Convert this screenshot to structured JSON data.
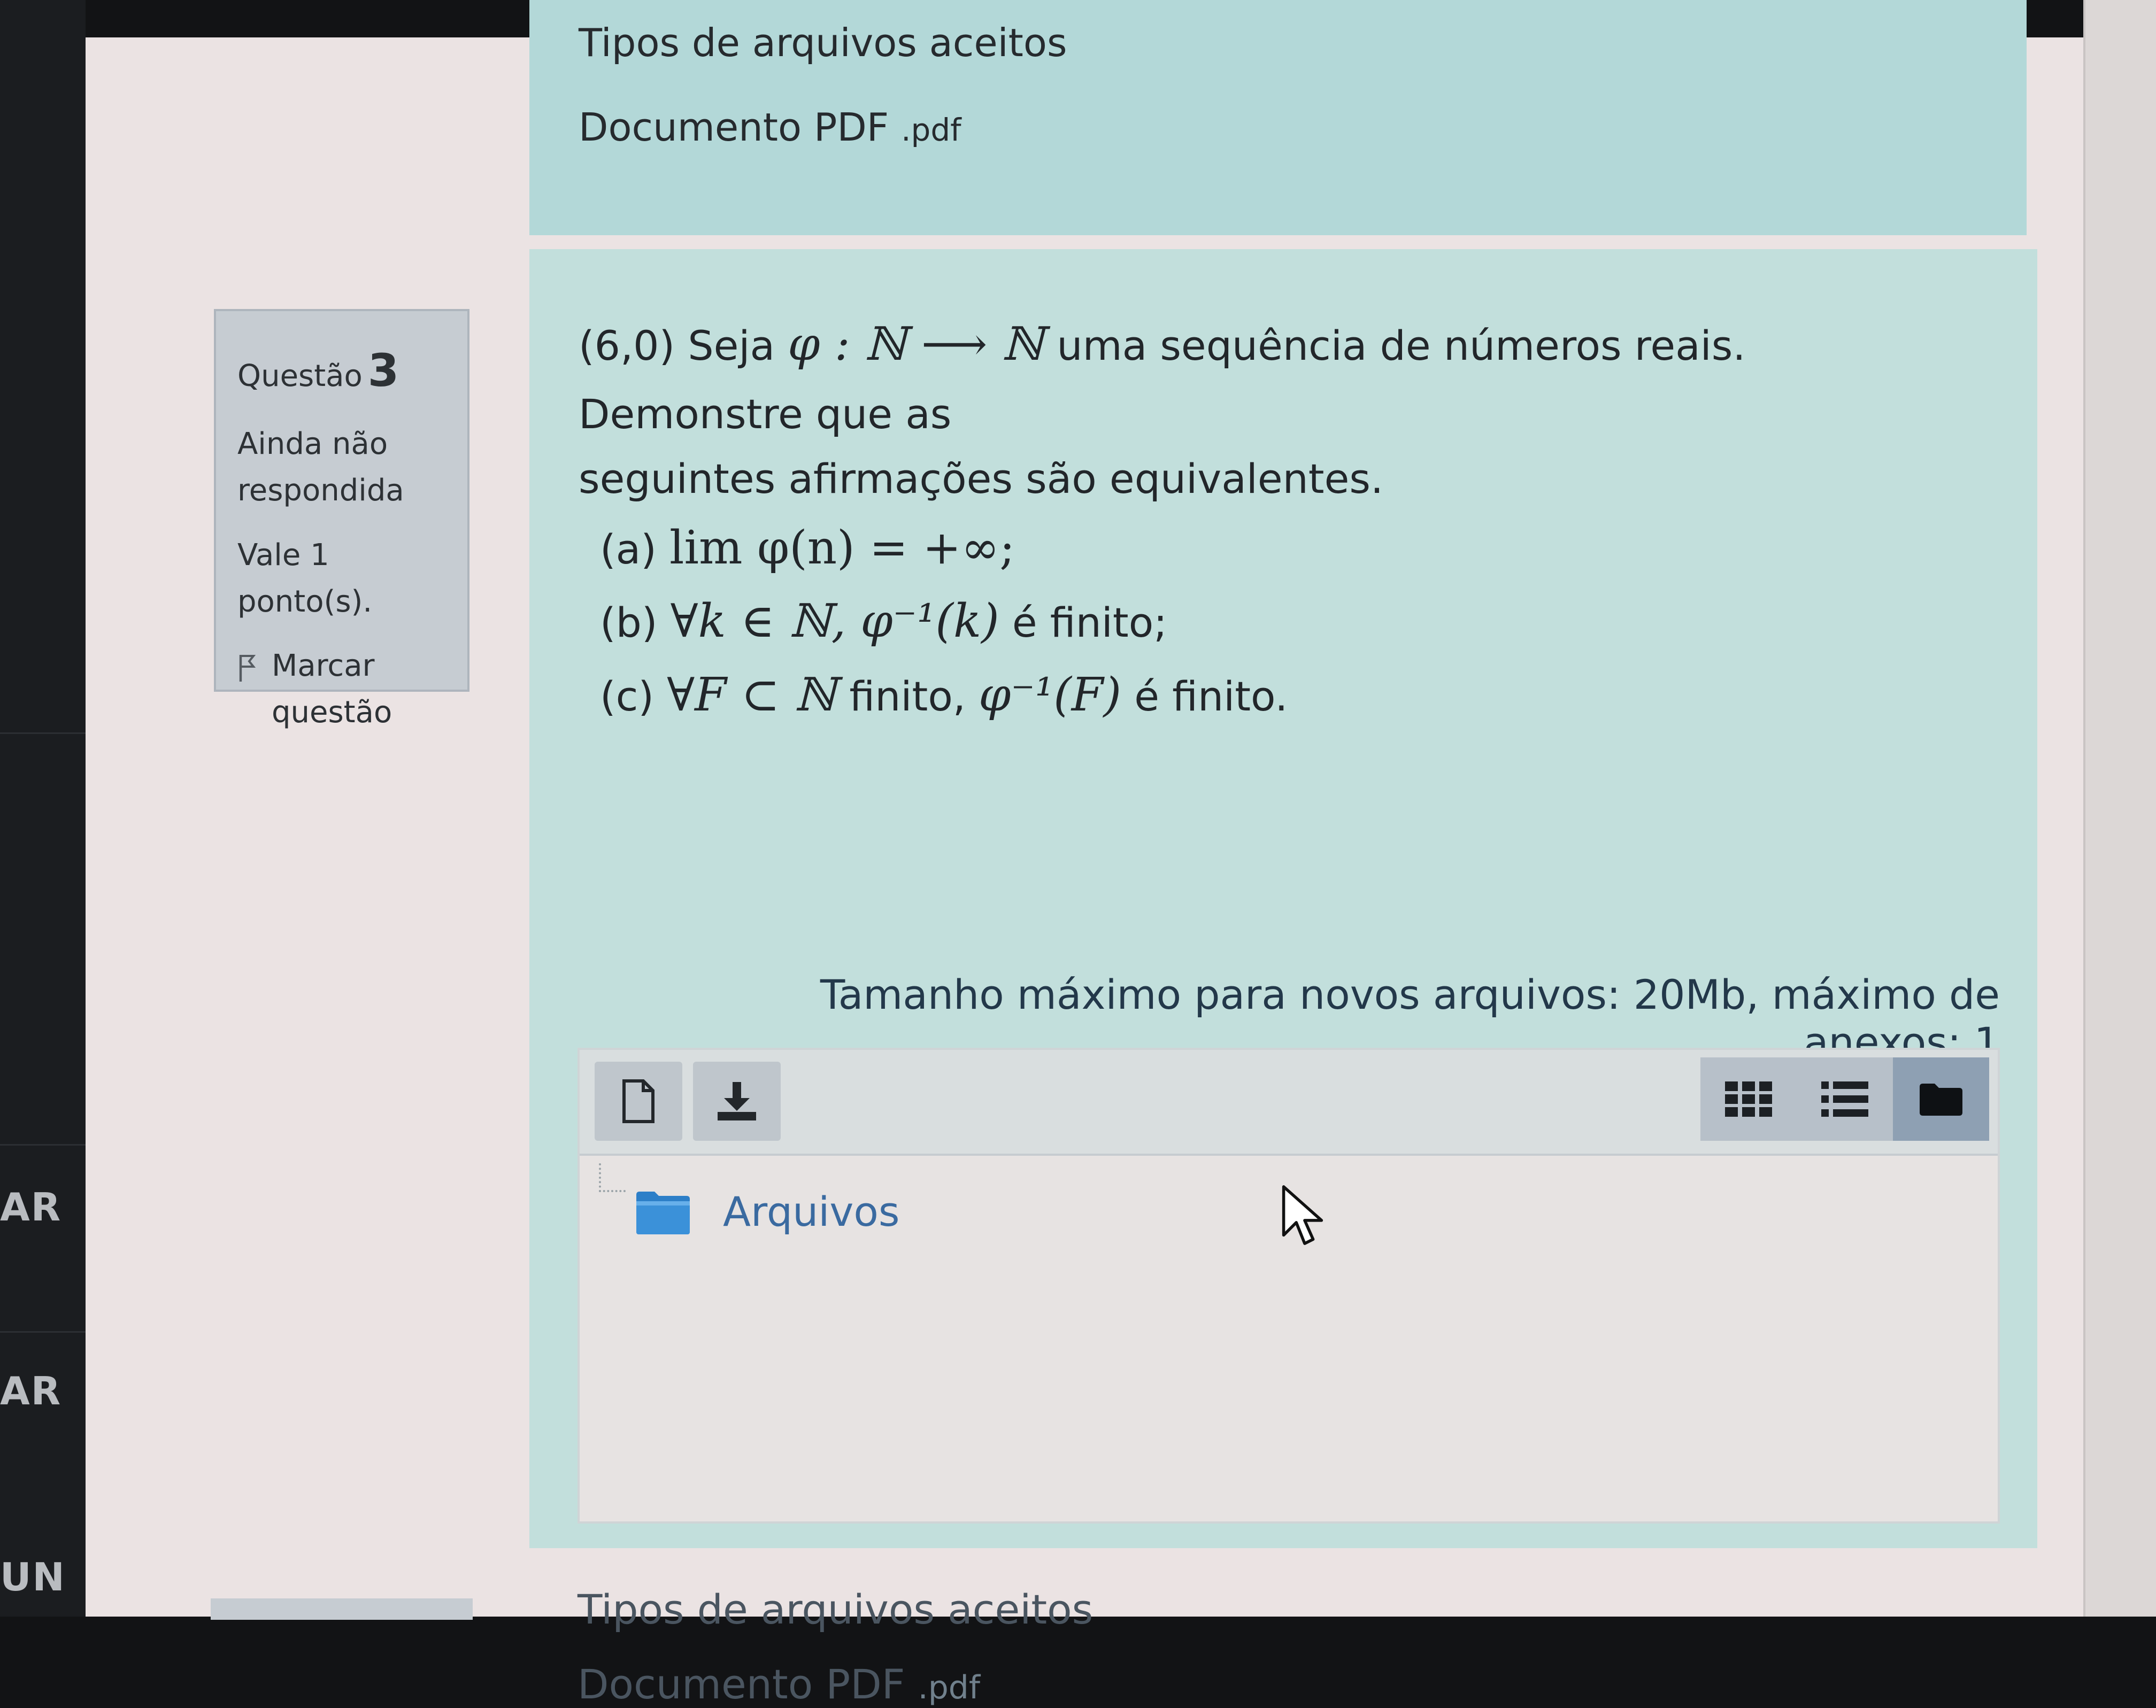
{
  "sidebar": {
    "items": [
      "AR",
      "AR",
      "UN"
    ]
  },
  "previous_question": {
    "accepted_types_label": "Tipos de arquivos aceitos",
    "accepted_type_name": "Documento PDF",
    "accepted_type_ext": ".pdf"
  },
  "question_info": {
    "label": "Questão",
    "number": "3",
    "status_line1": "Ainda não",
    "status_line2": "respondida",
    "points": "Vale 1 ponto(s).",
    "flag_line1": "Marcar",
    "flag_line2": "questão",
    "flag_icon": "flag-icon"
  },
  "question": {
    "intro_prefix": "(6,0) Seja",
    "intro_math": "φ : ℕ ⟶ ℕ",
    "intro_suffix": "uma sequência de números reais. Demonstre que as",
    "intro_line2": "seguintes afirmações são equivalentes.",
    "item_a_label": "(a)",
    "item_a_math": "lim φ(n) = +∞;",
    "item_b_label": "(b)",
    "item_b_math": "∀k ∈ ℕ, φ⁻¹(k)",
    "item_b_suffix": "é finito;",
    "item_c_label": "(c)",
    "item_c_math": "∀F ⊂ ℕ",
    "item_c_mid": "finito,",
    "item_c_math2": "φ⁻¹(F)",
    "item_c_suffix": "é finito."
  },
  "filepicker": {
    "limits_text": "Tamanho máximo para novos arquivos: 20Mb, máximo de anexos: 1",
    "add_file_icon": "add-file-icon",
    "download_icon": "download-icon",
    "view_icons_icon": "grid-view-icon",
    "view_list_icon": "list-view-icon",
    "view_tree_icon": "folder-view-icon",
    "folder_label": "Arquivos"
  },
  "accepted": {
    "label": "Tipos de arquivos aceitos",
    "type_name": "Documento PDF",
    "type_ext": ".pdf"
  },
  "colors": {
    "content_bg": "#c2dfdc",
    "info_bg": "#b3d8d8",
    "qinfo_bg": "#c6ccd2",
    "link": "#3a6aa0",
    "active_view": "#8ea0b3"
  }
}
